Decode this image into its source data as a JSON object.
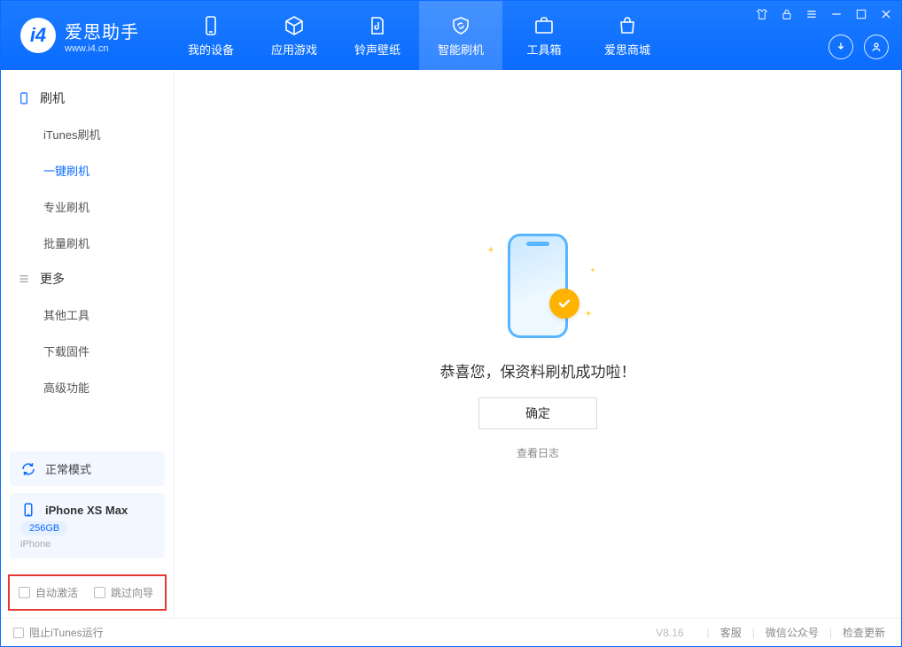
{
  "brand": {
    "name": "爱思助手",
    "url": "www.i4.cn"
  },
  "tabs": [
    {
      "id": "device",
      "label": "我的设备"
    },
    {
      "id": "apps",
      "label": "应用游戏"
    },
    {
      "id": "ringtone",
      "label": "铃声壁纸"
    },
    {
      "id": "flash",
      "label": "智能刷机"
    },
    {
      "id": "toolbox",
      "label": "工具箱"
    },
    {
      "id": "store",
      "label": "爱思商城"
    }
  ],
  "activeTab": "flash",
  "sidebar": {
    "groups": [
      {
        "id": "flash",
        "label": "刷机",
        "items": [
          {
            "id": "itunes",
            "label": "iTunes刷机"
          },
          {
            "id": "onekey",
            "label": "一键刷机"
          },
          {
            "id": "pro",
            "label": "专业刷机"
          },
          {
            "id": "batch",
            "label": "批量刷机"
          }
        ]
      },
      {
        "id": "more",
        "label": "更多",
        "items": [
          {
            "id": "other",
            "label": "其他工具"
          },
          {
            "id": "download",
            "label": "下载固件"
          },
          {
            "id": "advanced",
            "label": "高级功能"
          }
        ]
      }
    ],
    "activeItem": "onekey",
    "status": {
      "mode": "正常模式",
      "device": "iPhone XS Max",
      "storage": "256GB",
      "type": "iPhone"
    },
    "checks": {
      "autoActivate": "自动激活",
      "skipGuide": "跳过向导"
    }
  },
  "main": {
    "successMsg": "恭喜您，保资料刷机成功啦！",
    "confirm": "确定",
    "viewLog": "查看日志"
  },
  "footer": {
    "blockItunes": "阻止iTunes运行",
    "version": "V8.16",
    "links": [
      "客服",
      "微信公众号",
      "检查更新"
    ]
  }
}
